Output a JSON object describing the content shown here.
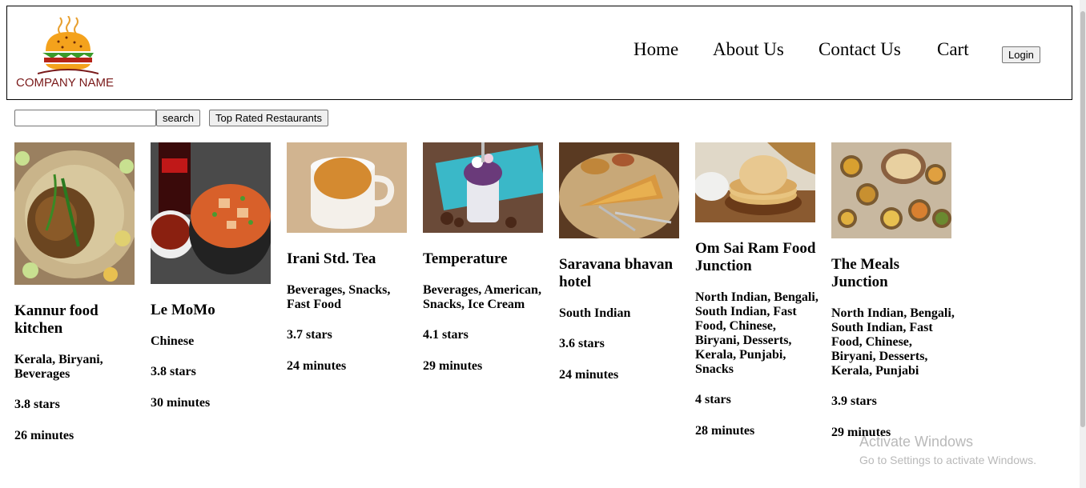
{
  "header": {
    "logo_text": "COMPANY NAME",
    "nav": [
      "Home",
      "About Us",
      "Contact Us",
      "Cart"
    ],
    "login_label": "Login"
  },
  "toolbar": {
    "search_value": "",
    "search_label": "search",
    "top_rated_label": "Top Rated Restaurants"
  },
  "restaurants": [
    {
      "name": "Kannur food kitchen",
      "cuisine": "Kerala, Biryani, Beverages",
      "rating": "3.8 stars",
      "time": "26 minutes",
      "image": "grilled-chicken-biryani"
    },
    {
      "name": "Le MoMo",
      "cuisine": "Chinese",
      "rating": "3.8 stars",
      "time": "30 minutes",
      "image": "fried-rice-with-cola"
    },
    {
      "name": "Irani Std. Tea",
      "cuisine": "Beverages, Snacks, Fast Food",
      "rating": "3.7 stars",
      "time": "24 minutes",
      "image": "cup-of-tea"
    },
    {
      "name": "Temperature",
      "cuisine": "Beverages, American, Snacks, Ice Cream",
      "rating": "4.1 stars",
      "time": "29 minutes",
      "image": "freakshake-dessert"
    },
    {
      "name": "Saravana bhavan hotel",
      "cuisine": "South Indian",
      "rating": "3.6 stars",
      "time": "24 minutes",
      "image": "masala-dosa"
    },
    {
      "name": "Om Sai Ram Food Junction",
      "cuisine": "North Indian, Bengali, South Indian, Fast Food, Chinese, Biryani, Desserts, Kerala, Punjabi, Snacks",
      "rating": "4 stars",
      "time": "28 minutes",
      "image": "rotis-stack"
    },
    {
      "name": "The Meals Junction",
      "cuisine": "North Indian, Bengali, South Indian, Fast Food, Chinese, Biryani, Desserts, Kerala, Punjabi",
      "rating": "3.9 stars",
      "time": "29 minutes",
      "image": "thali-bowls"
    }
  ],
  "watermark": {
    "line1": "Activate Windows",
    "line2": "Go to Settings to activate Windows."
  },
  "colors": {
    "logo_text": "#7a1a1a",
    "button_bg": "#efefef"
  }
}
